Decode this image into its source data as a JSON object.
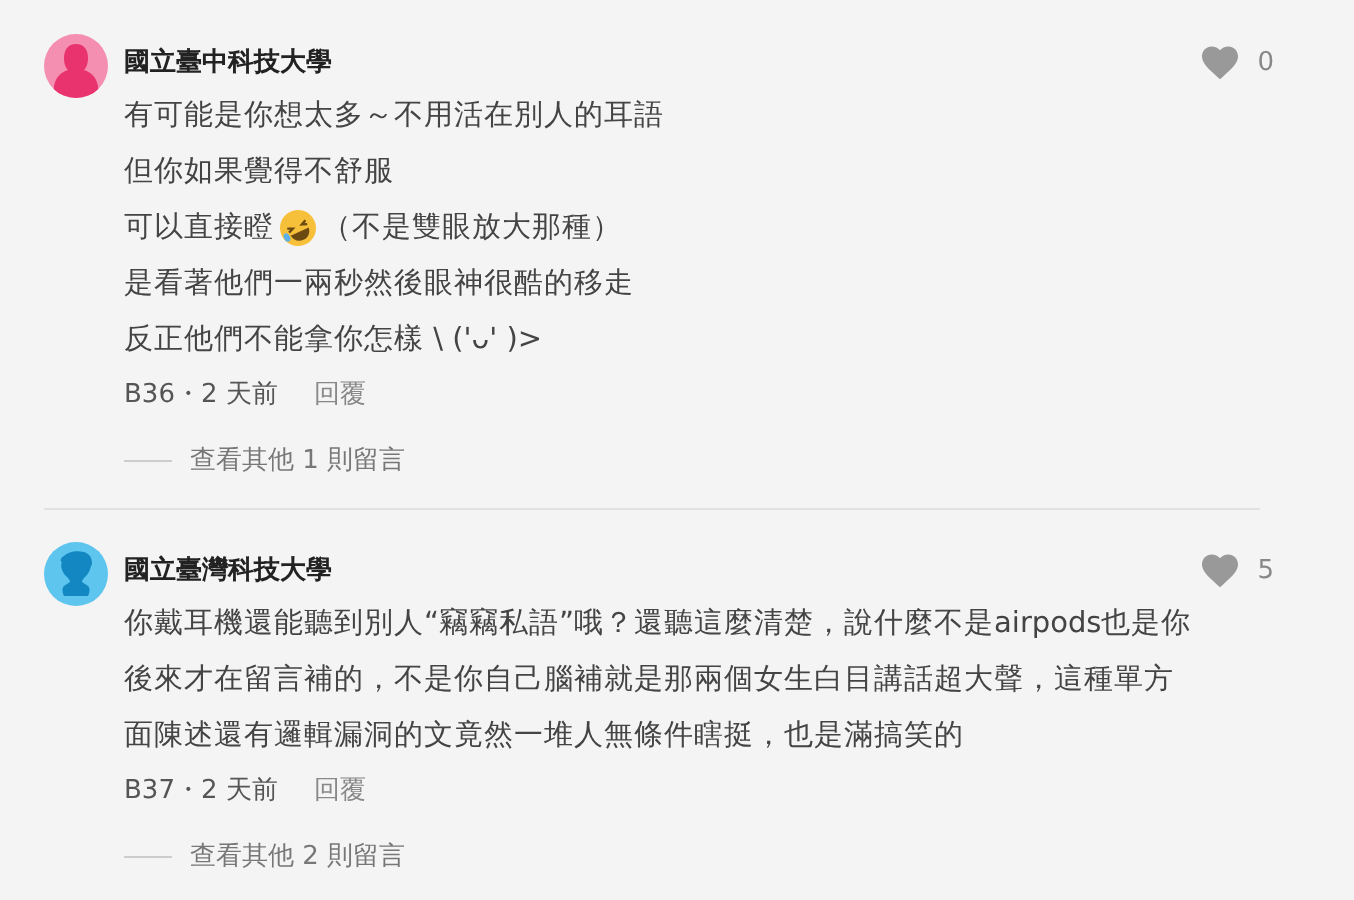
{
  "comments": [
    {
      "author": "國立臺中科技大學",
      "avatar": {
        "kind": "female",
        "color": "#f48fb1"
      },
      "likes": "0",
      "lines": [
        {
          "kind": "text",
          "text": "有可能是你想太多～不用活在別人的耳語"
        },
        {
          "kind": "text",
          "text": "但你如果覺得不舒服"
        },
        {
          "kind": "emoji",
          "before": "可以直接瞪",
          "after": "（不是雙眼放大那種）"
        },
        {
          "kind": "text",
          "text": "是看著他們一兩秒然後眼神很酷的移走"
        },
        {
          "kind": "text",
          "text": "反正他們不能拿你怎樣 \\ ('ᴗ' )>"
        }
      ],
      "meta": "B36・2 天前",
      "reply": "回覆",
      "more_replies": "查看其他 1 則留言"
    },
    {
      "author": "國立臺灣科技大學",
      "avatar": {
        "kind": "male",
        "color": "#5ec5ef"
      },
      "likes": "5",
      "lines": [
        {
          "kind": "text",
          "text": "你戴耳機還能聽到別人“竊竊私語”哦？還聽這麼清楚，說什麼不是airpods也是你"
        },
        {
          "kind": "text",
          "text": "後來才在留言補的，不是你自己腦補就是那兩個女生白目講話超大聲，這種單方"
        },
        {
          "kind": "text",
          "text": "面陳述還有邏輯漏洞的文竟然一堆人無條件瞎挺，也是滿搞笑的"
        }
      ],
      "meta": "B37・2 天前",
      "reply": "回覆",
      "more_replies": "查看其他 2 則留言"
    }
  ]
}
